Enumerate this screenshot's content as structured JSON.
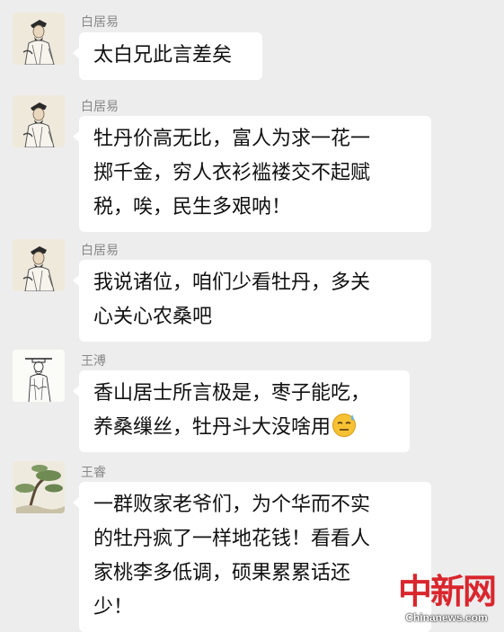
{
  "messages": [
    {
      "sender": "白居易",
      "avatar": "portrait-bai-juyi-icon",
      "lines": [
        "太白兄此言差矣"
      ]
    },
    {
      "sender": "白居易",
      "avatar": "portrait-bai-juyi-icon",
      "lines": [
        "牡丹价高无比，富人为求一花一",
        "掷千金，穷人衣衫褴褛交不起赋",
        "税，唉，民生多艰呐！"
      ]
    },
    {
      "sender": "白居易",
      "avatar": "portrait-bai-juyi-icon",
      "lines": [
        "我说诸位，咱们少看牡丹，多关",
        "心关心农桑吧"
      ]
    },
    {
      "sender": "王溥",
      "avatar": "line-drawing-portrait-icon",
      "lines": [
        "香山居士所言极是，枣子能吃，",
        "养桑缫丝，牡丹斗大没啥用"
      ],
      "emoji": "sweat-smile-emoji"
    },
    {
      "sender": "王睿",
      "avatar": "pine-tree-painting-icon",
      "lines": [
        "一群败家老爷们，为个华而不实",
        "的牡丹疯了一样地花钱！看看人",
        "家桃李多低调，硕果累累话还",
        "少！"
      ]
    }
  ],
  "watermark": {
    "logo": "中新网",
    "domain": "Chinanews.com"
  }
}
